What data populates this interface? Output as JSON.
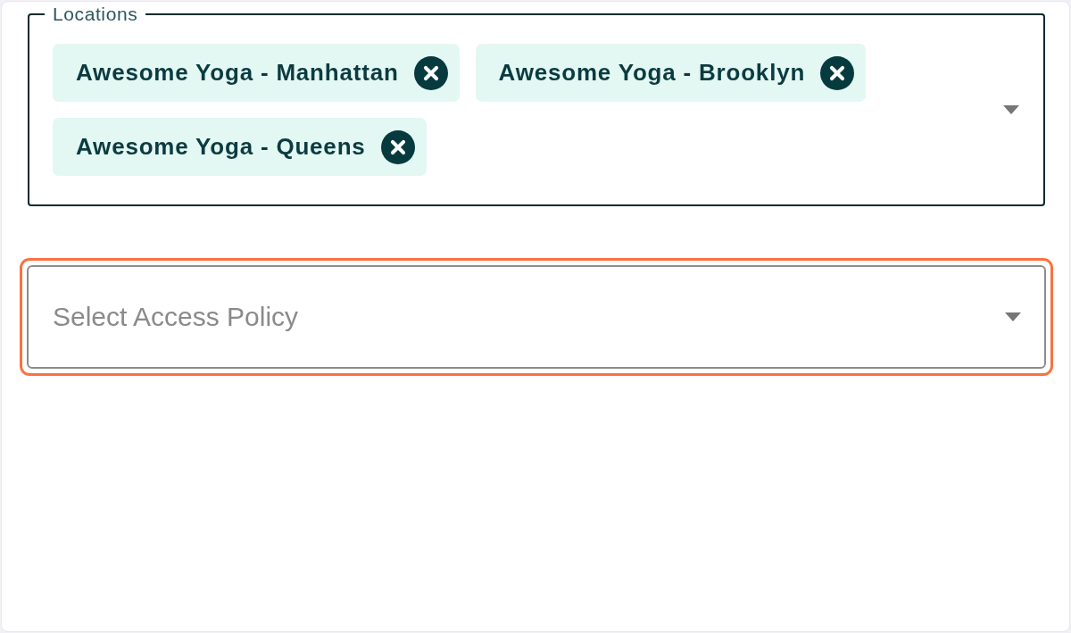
{
  "locations": {
    "label": "Locations",
    "chips": [
      {
        "label": "Awesome Yoga - Manhattan"
      },
      {
        "label": "Awesome Yoga - Brooklyn"
      },
      {
        "label": "Awesome Yoga - Queens"
      }
    ]
  },
  "access_policy": {
    "placeholder": "Select Access Policy",
    "highlighted": true
  }
}
